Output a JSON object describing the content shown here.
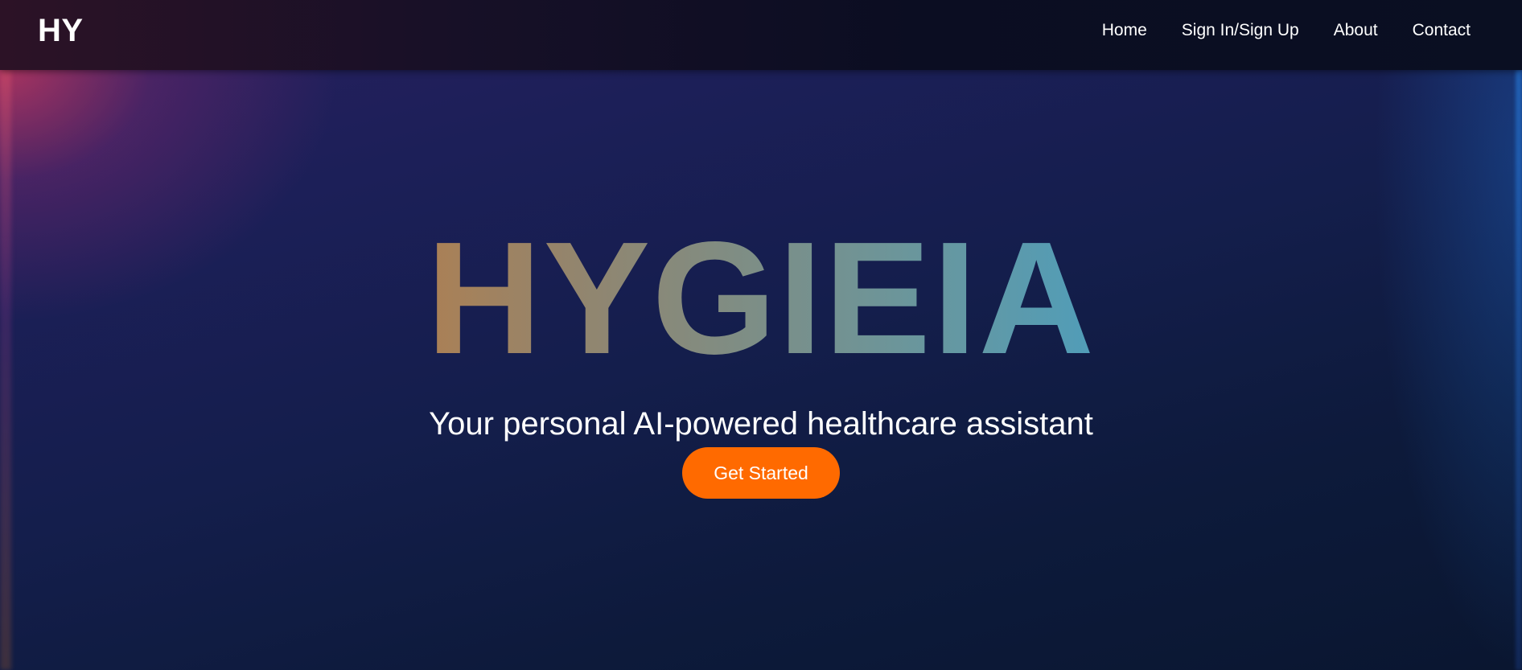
{
  "navbar": {
    "brand": "HY",
    "links": [
      {
        "label": "Home"
      },
      {
        "label": "Sign In/Sign Up"
      },
      {
        "label": "About"
      },
      {
        "label": "Contact"
      }
    ]
  },
  "hero": {
    "title": "HYGIEIA",
    "subtitle": "Your personal AI-powered healthcare assistant",
    "cta_label": "Get Started"
  },
  "colors": {
    "accent": "#ff6a00",
    "title_gradient_start": "#f56e14",
    "title_gradient_end": "#1ea6ea",
    "background_dark": "#0b1733"
  }
}
